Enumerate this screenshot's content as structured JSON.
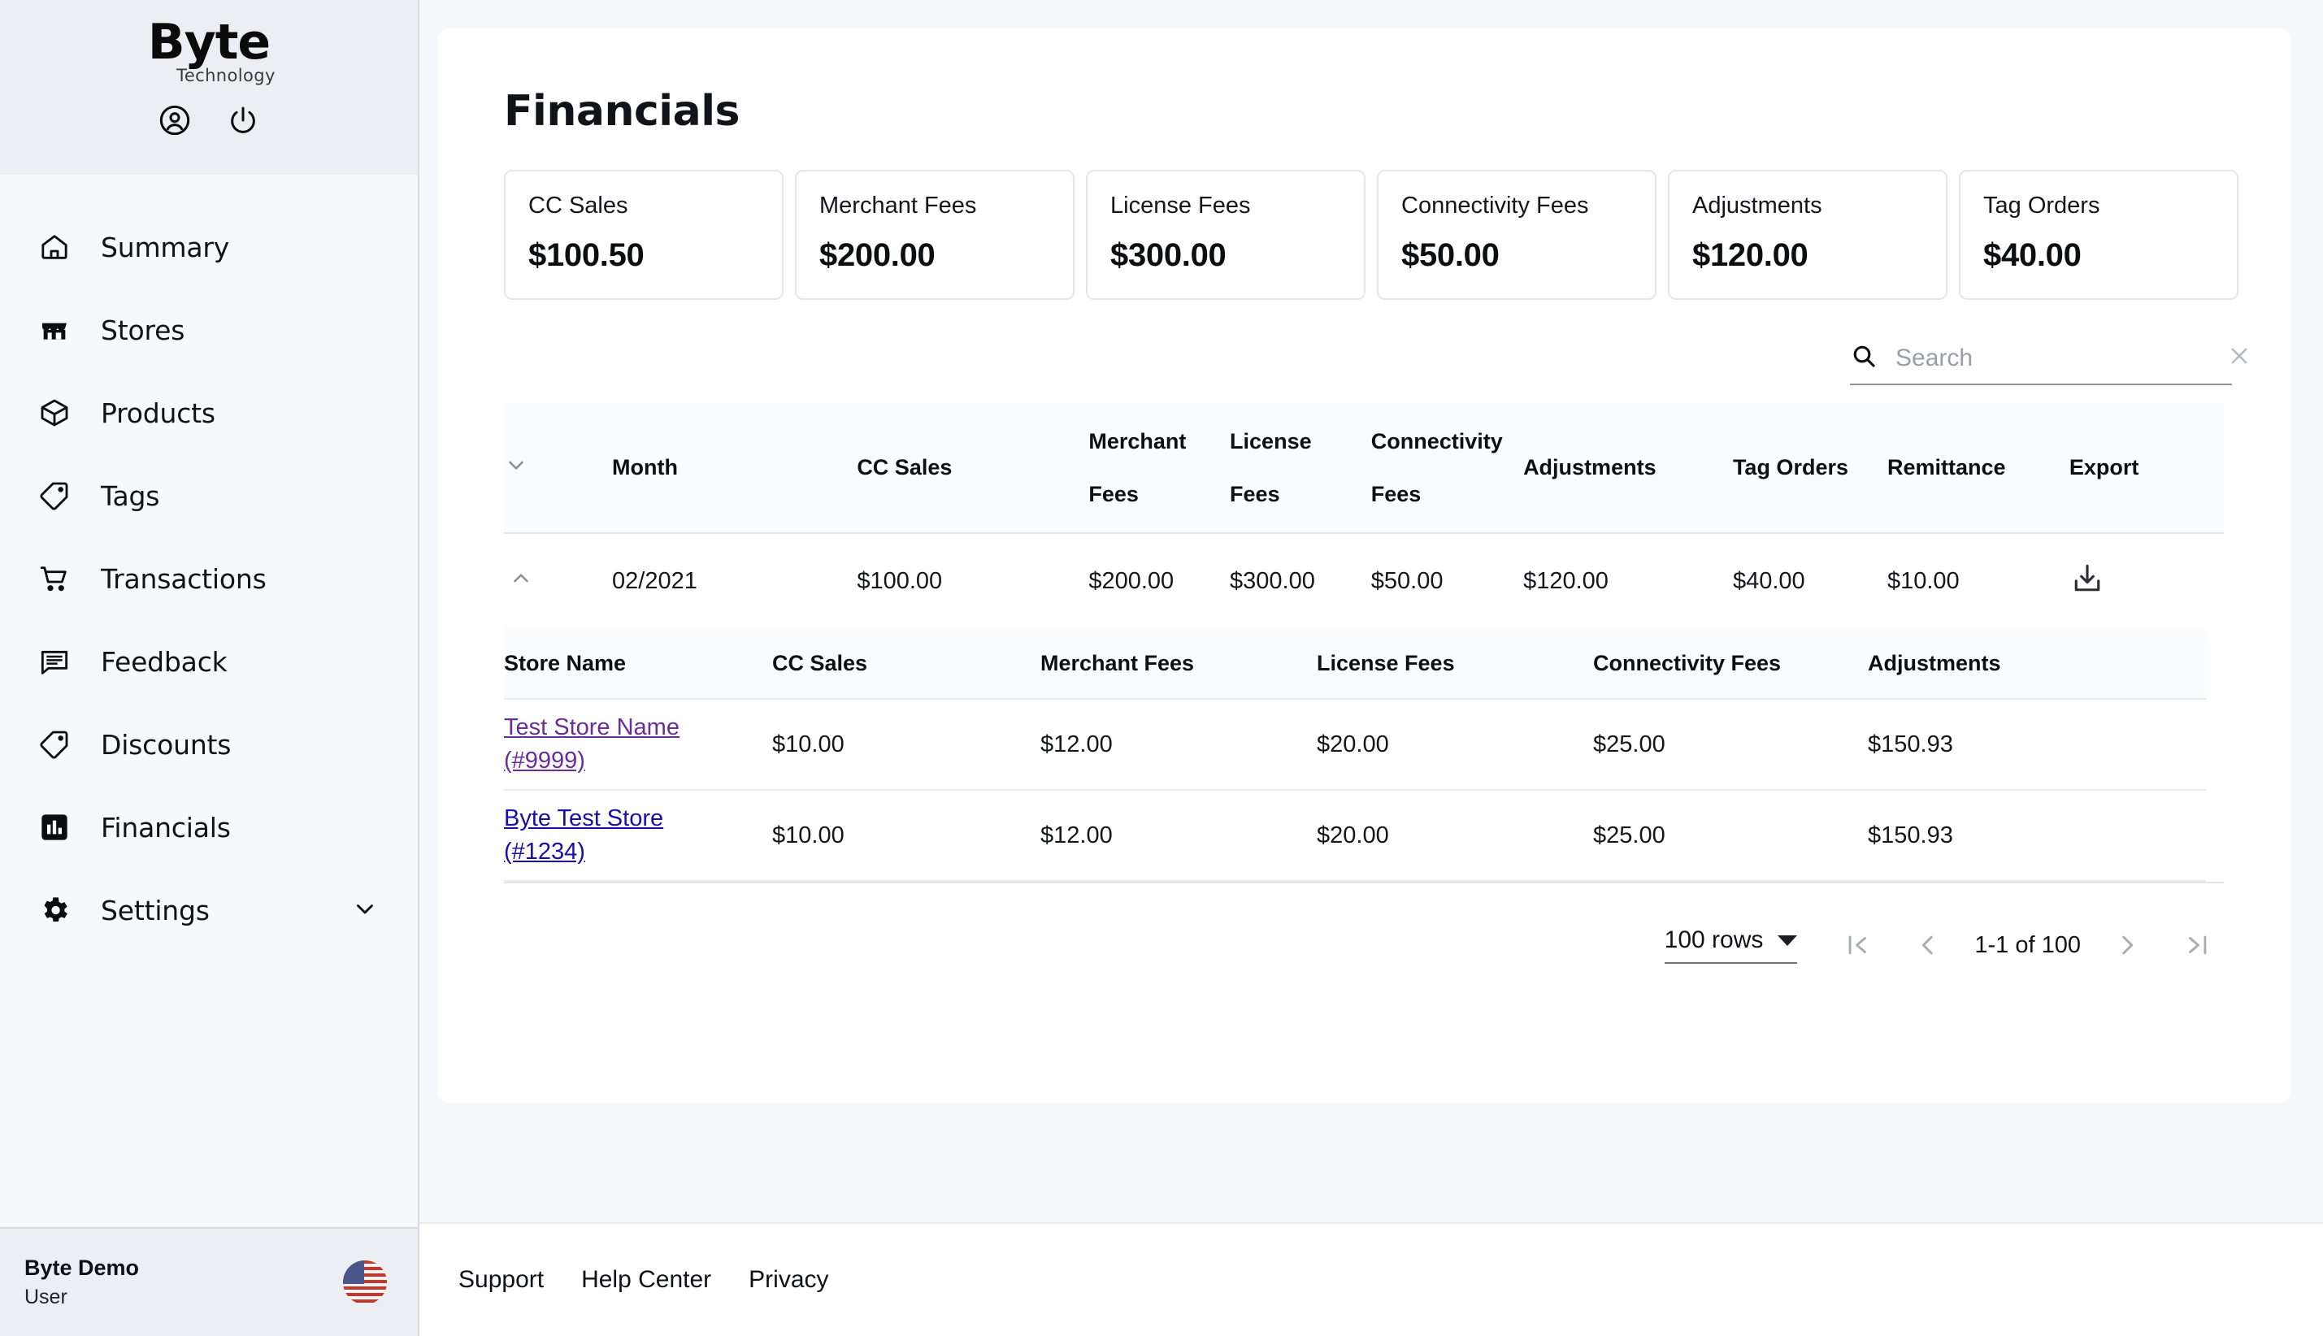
{
  "brand": {
    "name": "Byte",
    "tagline": "Technology",
    "account_icon": "account-circle-icon",
    "power_icon": "power-icon"
  },
  "sidebar": {
    "items": [
      {
        "label": "Summary",
        "icon": "home-icon",
        "active": false
      },
      {
        "label": "Stores",
        "icon": "storefront-icon",
        "active": false
      },
      {
        "label": "Products",
        "icon": "package-icon",
        "active": false
      },
      {
        "label": "Tags",
        "icon": "tag-icon",
        "active": false
      },
      {
        "label": "Transactions",
        "icon": "shopping-cart-icon",
        "active": false
      },
      {
        "label": "Feedback",
        "icon": "message-icon",
        "active": false
      },
      {
        "label": "Discounts",
        "icon": "tag-icon",
        "active": false
      },
      {
        "label": "Financials",
        "icon": "bar-chart-icon",
        "active": true
      },
      {
        "label": "Settings",
        "icon": "gear-icon",
        "active": false,
        "expandable": true
      }
    ],
    "user": {
      "name": "Byte Demo",
      "role": "User",
      "locale_flag": "us-flag-icon"
    }
  },
  "page": {
    "title": "Financials"
  },
  "stats": [
    {
      "label": "CC Sales",
      "value": "$100.50"
    },
    {
      "label": "Merchant Fees",
      "value": "$200.00"
    },
    {
      "label": "License Fees",
      "value": "$300.00"
    },
    {
      "label": "Connectivity Fees",
      "value": "$50.00"
    },
    {
      "label": "Adjustments",
      "value": "$120.00"
    },
    {
      "label": "Tag Orders",
      "value": "$40.00"
    }
  ],
  "search": {
    "placeholder": "Search",
    "value": "",
    "icon": "search-icon",
    "clear_icon": "close-icon"
  },
  "table": {
    "columns": [
      {
        "key": "toggle",
        "label": ""
      },
      {
        "key": "month",
        "label": "Month"
      },
      {
        "key": "cc_sales",
        "label": "CC Sales"
      },
      {
        "key": "merchant",
        "label": "Merchant Fees"
      },
      {
        "key": "license",
        "label": "License Fees"
      },
      {
        "key": "connectivity",
        "label": "Connectivity Fees"
      },
      {
        "key": "adjustments",
        "label": "Adjustments"
      },
      {
        "key": "tag_orders",
        "label": "Tag Orders"
      },
      {
        "key": "remittance",
        "label": "Remittance"
      },
      {
        "key": "export",
        "label": "Export"
      }
    ],
    "header_labels": {
      "month": "Month",
      "cc_sales": "CC Sales",
      "merchant_l1": "Merchant",
      "merchant_l2": "Fees",
      "license_l1": "License",
      "license_l2": "Fees",
      "connectivity_l1": "Connectivity",
      "connectivity_l2": "Fees",
      "adjustments": "Adjustments",
      "tag_orders": "Tag Orders",
      "remittance": "Remittance",
      "export": "Export"
    },
    "row": {
      "month": "02/2021",
      "cc_sales": "$100.00",
      "merchant": "$200.00",
      "license": "$300.00",
      "connectivity": "$50.00",
      "adjustments": "$120.00",
      "tag_orders": "$40.00",
      "remittance": "$10.00",
      "export_icon": "download-icon",
      "expanded": true,
      "collapse_icon": "chevron-up-icon"
    },
    "sort_icon": "chevron-down-icon",
    "nested": {
      "columns": [
        "Store Name",
        "CC Sales",
        "Merchant Fees",
        "License Fees",
        "Connectivity Fees",
        "Adjustments"
      ],
      "rows": [
        {
          "store_name": "Test Store Name",
          "store_id": "(#9999)",
          "visited": true,
          "cc_sales": "$10.00",
          "merchant": "$12.00",
          "license": "$20.00",
          "connectivity": "$25.00",
          "adjustments": "$150.93"
        },
        {
          "store_name": "Byte Test Store",
          "store_id": "(#1234)",
          "visited": false,
          "cc_sales": "$10.00",
          "merchant": "$12.00",
          "license": "$20.00",
          "connectivity": "$25.00",
          "adjustments": "$150.93"
        }
      ]
    }
  },
  "pagination": {
    "rows_per_page": "100 rows",
    "range_label": "1-1 of 100",
    "first_icon": "first-page-icon",
    "prev_icon": "chevron-left-icon",
    "next_icon": "chevron-right-icon",
    "last_icon": "last-page-icon"
  },
  "footer": {
    "links": [
      "Support",
      "Help Center",
      "Privacy"
    ]
  },
  "colors": {
    "sidebar_bg": "#f7f8fc",
    "sidebar_panel": "#eceef3",
    "page_bg": "#f7f8fc",
    "card_bg": "#ffffff",
    "link": "#1a0dab",
    "link_visited": "#6a2d9b",
    "text": "#15161b",
    "muted": "#8b8e96"
  }
}
